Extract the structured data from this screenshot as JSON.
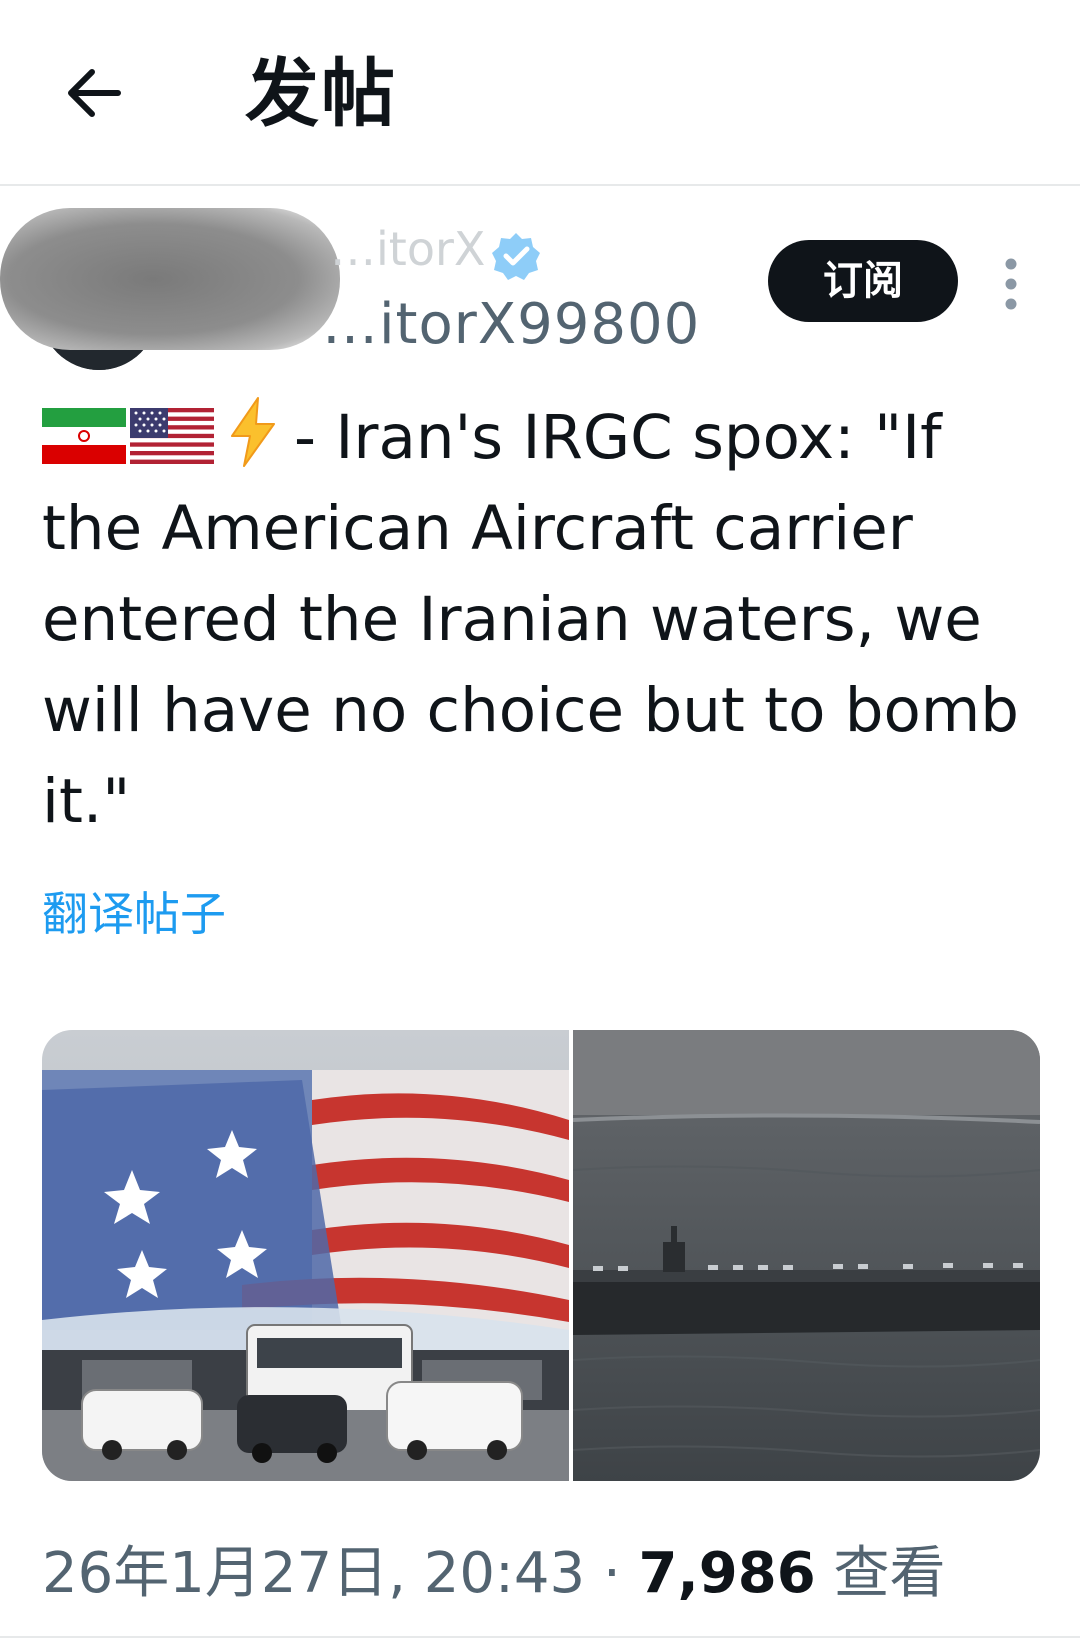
{
  "header": {
    "title": "发帖",
    "back_icon": "arrow-left-icon"
  },
  "author": {
    "display_name": "…itorX",
    "handle": "…itorX99800",
    "verified_icon": "verified-badge-icon",
    "subscribe_label": "订阅"
  },
  "post": {
    "flags": [
      "iran-flag-icon",
      "us-flag-icon"
    ],
    "emoji_icon": "lightning-icon",
    "text": "- Iran's IRGC spox: \"If the American Aircraft carrier entered the Iranian waters, we will have no choice but to bomb it.\"",
    "translate_label": "翻译帖子"
  },
  "media": [
    {
      "name": "mural-image",
      "description": ""
    },
    {
      "name": "carrier-image",
      "description": ""
    }
  ],
  "meta": {
    "timestamp": "26年1月27日, 20:43",
    "separator": " · ",
    "views_count": "7,986",
    "views_label": " 查看"
  },
  "colors": {
    "accent": "#1d9bf0",
    "text": "#0f1419",
    "secondary": "#536471"
  }
}
